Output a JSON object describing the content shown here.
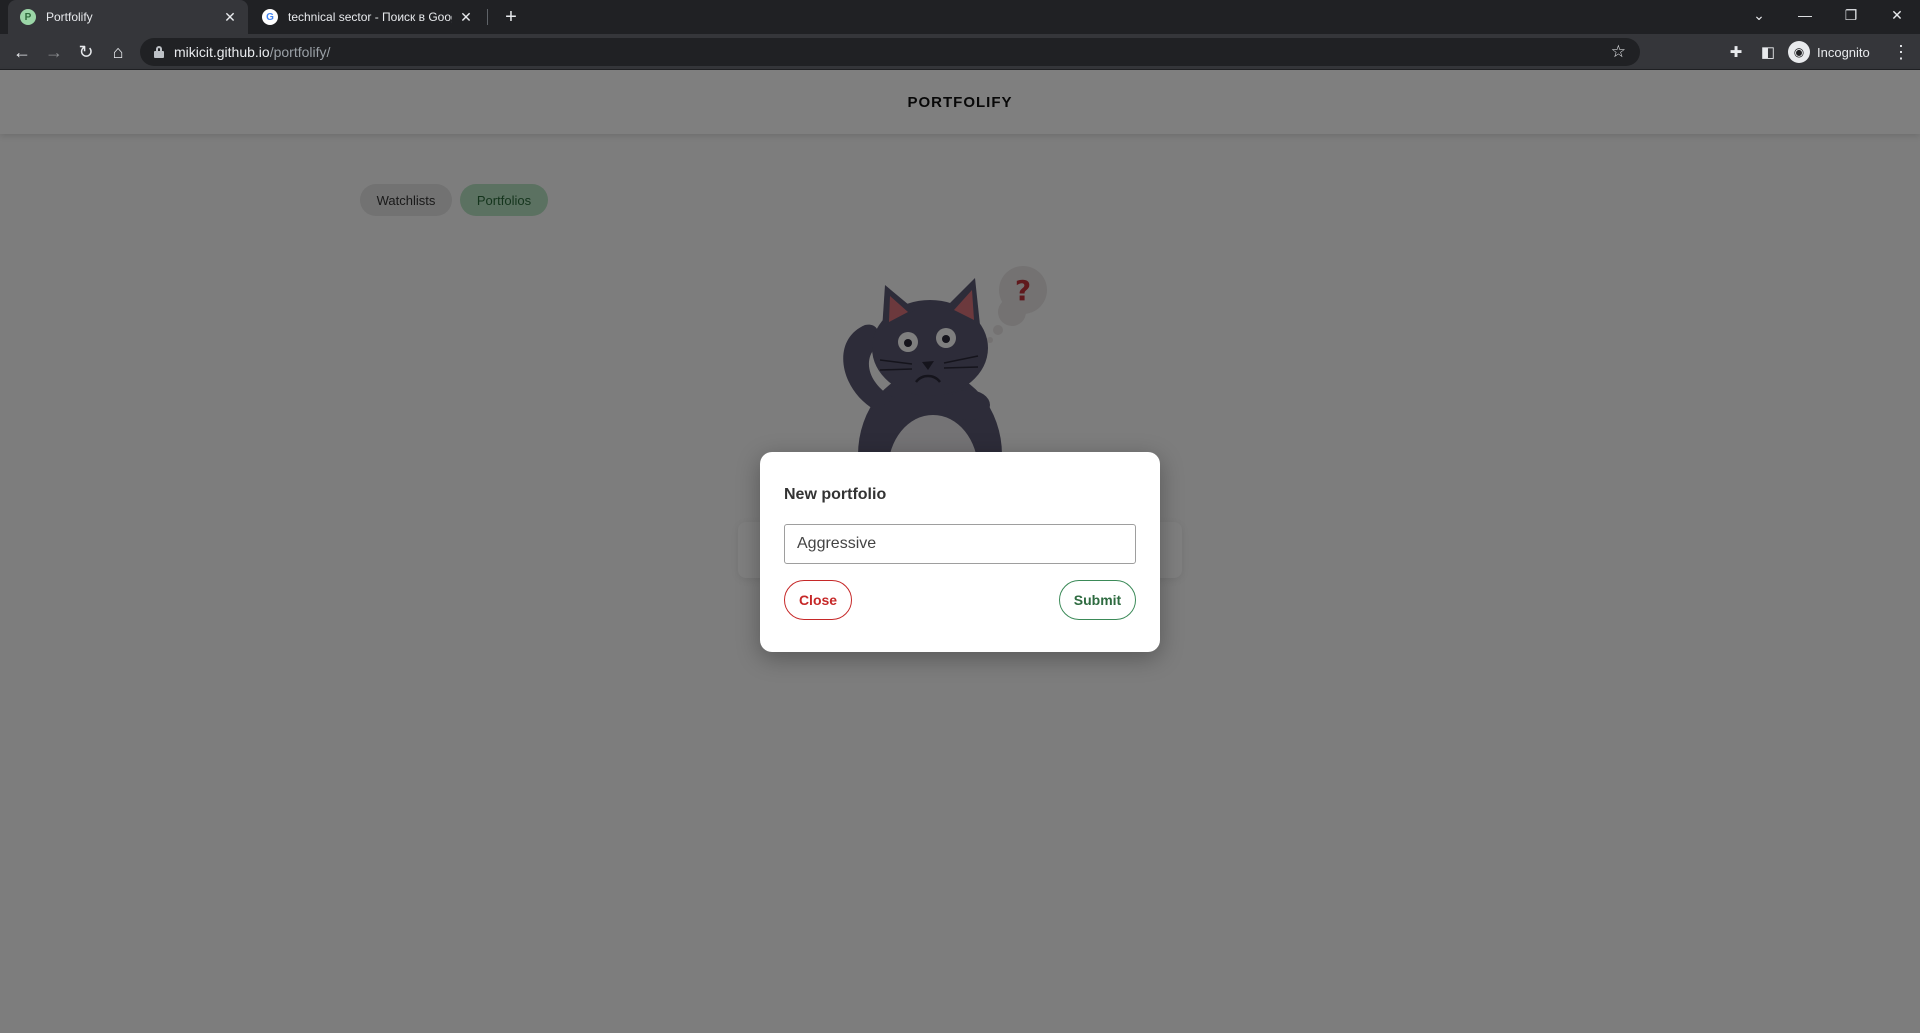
{
  "browser": {
    "tabs": [
      {
        "title": "Portfolify",
        "favicon": "P",
        "active": true
      },
      {
        "title": "technical sector - Поиск в Googl",
        "favicon": "G",
        "active": false
      }
    ],
    "url": {
      "host": "mikicit.github.io",
      "path": "/portfolify/"
    },
    "profile_label": "Incognito"
  },
  "site": {
    "logo": "PORTFOLIFY",
    "tabs": [
      "Watchlists",
      "Portfolios"
    ],
    "active_tab": "Portfolios",
    "illustration": "confused-cat-with-question-mark"
  },
  "modal": {
    "title": "New portfolio",
    "input_value": "Aggressive",
    "close_label": "Close",
    "submit_label": "Submit"
  },
  "colors": {
    "accent_green": "#2e6b40",
    "danger_red": "#c62828",
    "pill_active_bg": "#b7e2c2",
    "overlay": "rgba(0,0,0,0.5)"
  }
}
